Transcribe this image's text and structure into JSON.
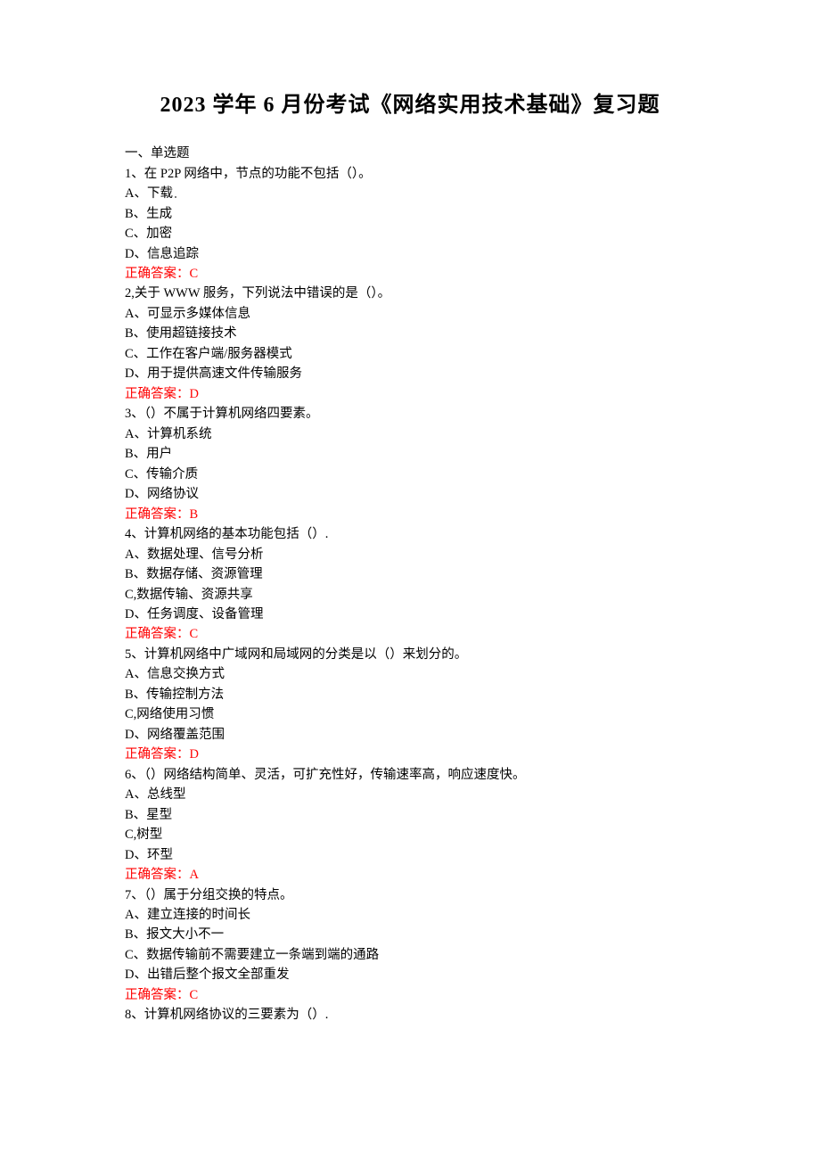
{
  "title": "2023 学年 6 月份考试《网络实用技术基础》复习题",
  "section": "一、单选题",
  "questions": [
    {
      "stem": "1、在 P2P 网络中，节点的功能不包括（）。",
      "opts": [
        "A、下载",
        "B、生成",
        "C、加密",
        "D、信息追踪"
      ],
      "answer": "正确答案：C",
      "special_dot_after_first": true
    },
    {
      "stem": "2,关于 WWW 服务，下列说法中错误的是（）。",
      "opts": [
        "A、可显示多媒体信息",
        "B、使用超链接技术",
        "C、工作在客户端/服务器模式",
        "D、用于提供高速文件传输服务"
      ],
      "answer": "正确答案：D"
    },
    {
      "stem": "3、（）不属于计算机网络四要素。",
      "opts": [
        "A、计算机系统",
        "B、用户",
        "C、传输介质",
        "D、网络协议"
      ],
      "answer": "正确答案：B"
    },
    {
      "stem": "4、计算机网络的基本功能包括（）.",
      "opts": [
        "A、数据处理、信号分析",
        "B、数据存储、资源管理",
        "C,数据传输、资源共享",
        "D、任务调度、设备管理"
      ],
      "answer": "正确答案：C"
    },
    {
      "stem": "5、计算机网络中广域网和局域网的分类是以（）来划分的。",
      "opts": [
        "A、信息交换方式",
        "B、传输控制方法",
        "C,网络使用习惯",
        "D、网络覆盖范围"
      ],
      "answer": "正确答案：D"
    },
    {
      "stem": "6、（）网络结构简单、灵活，可扩充性好，传输速率高，响应速度快。",
      "opts": [
        "A、总线型",
        "B、星型",
        "C,树型",
        "D、环型"
      ],
      "answer": "正确答案：A"
    },
    {
      "stem": "7、（）属于分组交换的特点。",
      "opts": [
        "A、建立连接的时间长",
        "B、报文大小不一",
        "C、数据传输前不需要建立一条端到端的通路",
        "D、出错后整个报文全部重发"
      ],
      "answer": "正确答案：C"
    },
    {
      "stem": "8、计算机网络协议的三要素为（）.",
      "opts": [],
      "answer": ""
    }
  ]
}
